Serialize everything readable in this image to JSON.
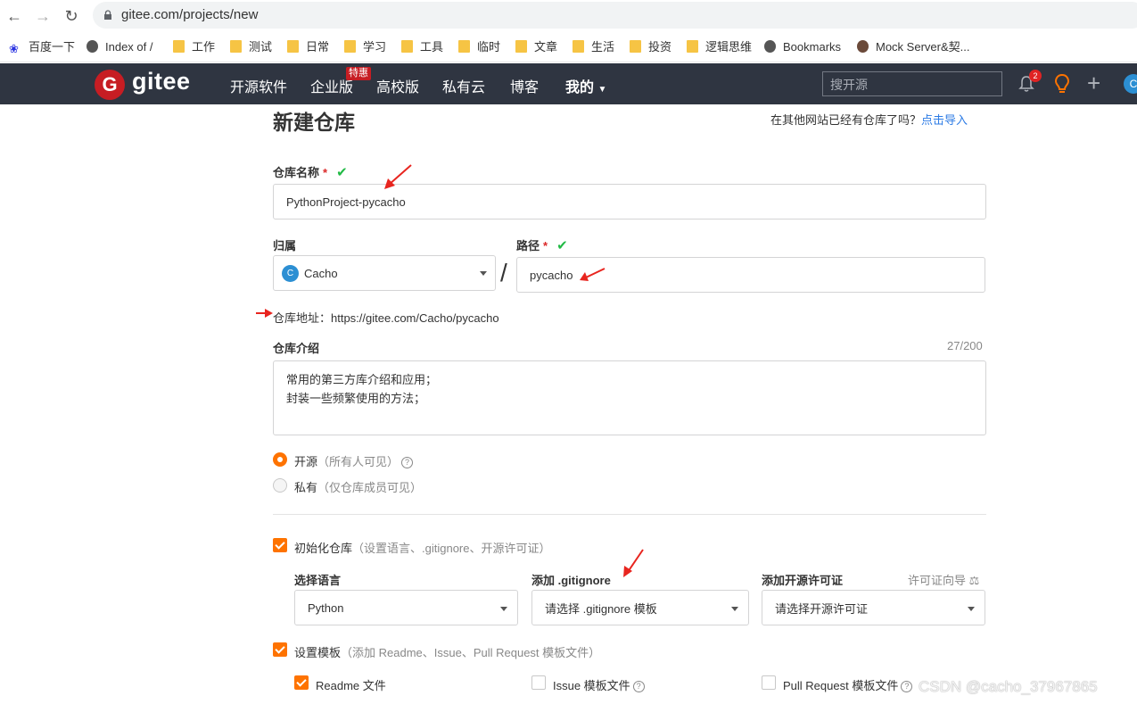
{
  "browser": {
    "url": "gitee.com/projects/new",
    "bookmarks": [
      {
        "label": "百度一下",
        "icon": "baidu-icon"
      },
      {
        "label": "Index of /",
        "icon": "globe-icon"
      },
      {
        "label": "工作",
        "icon": "folder-icon"
      },
      {
        "label": "测试",
        "icon": "folder-icon"
      },
      {
        "label": "日常",
        "icon": "folder-icon"
      },
      {
        "label": "学习",
        "icon": "folder-icon"
      },
      {
        "label": "工具",
        "icon": "folder-icon"
      },
      {
        "label": "临时",
        "icon": "folder-icon"
      },
      {
        "label": "文章",
        "icon": "folder-icon"
      },
      {
        "label": "生活",
        "icon": "folder-icon"
      },
      {
        "label": "投资",
        "icon": "folder-icon"
      },
      {
        "label": "逻辑思维",
        "icon": "folder-icon"
      },
      {
        "label": "Bookmarks",
        "icon": "globe-icon"
      },
      {
        "label": "Mock Server&契...",
        "icon": "person-icon"
      }
    ]
  },
  "header": {
    "logo": "gitee",
    "logo_letter": "G",
    "nav": [
      "开源软件",
      "企业版",
      "高校版",
      "私有云",
      "博客",
      "我的"
    ],
    "badge_enterprise": "特惠",
    "search_placeholder": "搜开源",
    "notification_count": "2",
    "user_initial": "C",
    "brand_color": "#c71d23",
    "header_bg": "#2f3541"
  },
  "form": {
    "title": "新建仓库",
    "import_hint": "在其他网站已经有仓库了吗？",
    "import_link": "点击导入",
    "repo_name_label": "仓库名称",
    "required_mark": "*",
    "valid_mark": "✔",
    "repo_name_value": "PythonProject-pycacho",
    "owner_label": "归属",
    "owner_value": "Cacho",
    "owner_initial": "C",
    "path_label": "路径",
    "path_value": "pycacho",
    "slash": "/",
    "repo_address": "仓库地址：https://gitee.com/Cacho/pycacho",
    "intro_label": "仓库介绍",
    "intro_count": "27/200",
    "intro_line1": "常用的第三方库介绍和应用；",
    "intro_line2": "封装一些频繁使用的方法；",
    "visibility": [
      {
        "label": "开源",
        "hint": "（所有人可见）",
        "selected": true
      },
      {
        "label": "私有",
        "hint": "（仅仓库成员可见）",
        "selected": false
      }
    ],
    "init_label": "初始化仓库",
    "init_hint": "（设置语言、.gitignore、开源许可证）",
    "init_checked": true,
    "lang_label": "选择语言",
    "lang_value": "Python",
    "gitignore_label": "添加 .gitignore",
    "gitignore_value": "请选择 .gitignore 模板",
    "license_label": "添加开源许可证",
    "license_guide": "许可证向导",
    "license_value": "请选择开源许可证",
    "template_label": "设置模板",
    "template_hint": "（添加 Readme、Issue、Pull Request 模板文件）",
    "template_checked": true,
    "templates": [
      {
        "label": "Readme 文件",
        "checked": true
      },
      {
        "label": "Issue 模板文件",
        "checked": false
      },
      {
        "label": "Pull Request 模板文件",
        "checked": false
      }
    ],
    "accent_color": "#fe7300"
  },
  "watermark": "CSDN @cacho_37967865"
}
